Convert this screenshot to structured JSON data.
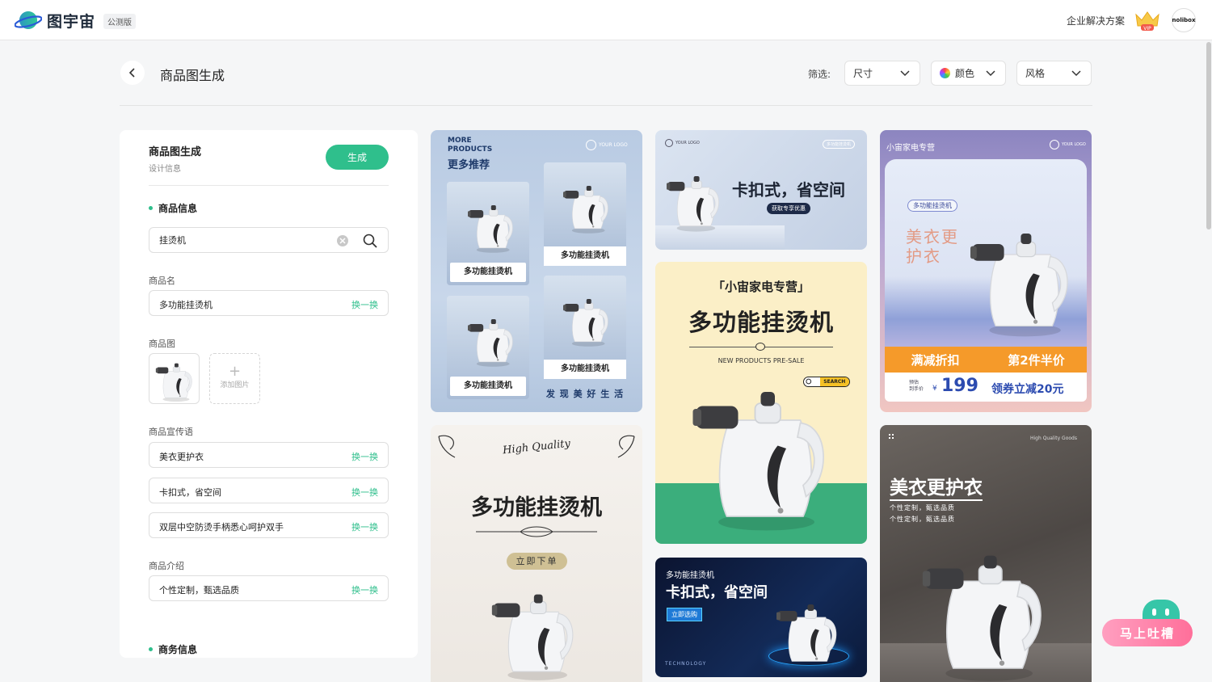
{
  "header": {
    "brand": "图宇宙",
    "beta_tag": "公测版",
    "enterprise_link": "企业解决方案",
    "vip_badge": "VIP",
    "avatar_text": "nolibox"
  },
  "page": {
    "title": "商品图生成",
    "filter_label": "筛选:",
    "filters": [
      {
        "label": "尺寸"
      },
      {
        "label": "颜色"
      },
      {
        "label": "风格"
      }
    ]
  },
  "panel": {
    "title": "商品图生成",
    "subtitle": "设计信息",
    "generate_label": "生成",
    "section_product": "商品信息",
    "search_value": "挂烫机",
    "name_label": "商品名",
    "name_value": "多功能挂烫机",
    "swap_label": "换一换",
    "image_label": "商品图",
    "add_image_label": "添加图片",
    "slogan_label": "商品宣传语",
    "slogans": [
      "美衣更护衣",
      "卡扣式，省空间",
      "双层中空防烫手柄悉心呵护双手"
    ],
    "intro_label": "商品介绍",
    "intro_value": "个性定制，甄选品质",
    "section_business": "商务信息"
  },
  "cards": {
    "c1": {
      "more_en": "MORE PRODUCTS",
      "more_zh": "更多推荐",
      "logo": "YOUR LOGO",
      "tile_label": "多功能挂烫机",
      "footer": "发 现 美 好 生 活"
    },
    "c2": {
      "logo": "YOUR LOGO",
      "tag": "多功能挂烫机",
      "headline": "卡扣式，省空间",
      "badge": "获取专享优惠"
    },
    "c3": {
      "shop": "小宙家电专营",
      "logo": "YOUR LOGO",
      "chip": "多功能挂烫机",
      "slogan_1": "美衣更",
      "slogan_2": "护衣",
      "promo_1": "满减折扣",
      "promo_2": "第2件半价",
      "pre_label_1": "预估",
      "pre_label_2": "到手价",
      "currency": "¥",
      "price": "199",
      "coupon": "领券立减20元"
    },
    "c4": {
      "shop": "「小宙家电专营」",
      "headline": "多功能挂烫机",
      "presale": "NEW PRODUCTS PRE-SALE",
      "search": "SEARCH"
    },
    "c5": {
      "script": "High Quality",
      "headline": "多功能挂烫机",
      "cta": "立即下单"
    },
    "c6": {
      "tag": "多功能挂烫机",
      "headline": "卡扣式，省空间",
      "cta": "立即选购",
      "footer": "TECHNOLOGY"
    },
    "c7": {
      "tagline": "High Quality Goods",
      "headline": "美衣更护衣",
      "line1": "个性定制，甄选品质",
      "line2": "个性定制，甄选品质"
    }
  },
  "feedback": {
    "label": "马上吐槽"
  },
  "colors": {
    "accent": "#2fbf8c",
    "promo_orange": "#f59a2a",
    "price_blue": "#2c4bb0"
  }
}
